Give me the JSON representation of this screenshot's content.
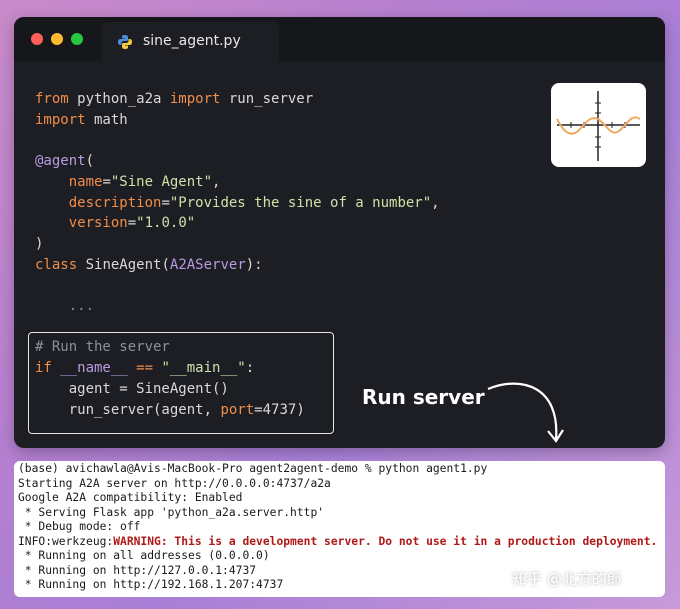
{
  "editor": {
    "tab_title": "sine_agent.py",
    "code": {
      "line1": {
        "kw_from": "from",
        "module": " python_a2a ",
        "kw_import": "import",
        "name": " run_server"
      },
      "line2": {
        "kw_import": "import",
        "name": " math"
      },
      "line4": {
        "decorator": "@agent",
        "paren": "("
      },
      "line5": {
        "indent": "    ",
        "param": "name",
        "eq": "=",
        "value": "\"Sine Agent\"",
        "comma": ","
      },
      "line6": {
        "indent": "    ",
        "param": "description",
        "eq": "=",
        "value": "\"Provides the sine of a number\"",
        "comma": ","
      },
      "line7": {
        "indent": "    ",
        "param": "version",
        "eq": "=",
        "value": "\"1.0.0\""
      },
      "line8": {
        "paren": ")"
      },
      "line9": {
        "kw_class": "class",
        "name": " SineAgent",
        "paren_open": "(",
        "base": "A2AServer",
        "paren_close": "):"
      },
      "line11": {
        "text": "    ..."
      },
      "line13": {
        "comment": "# Run the server"
      },
      "line14": {
        "kw_if": "if",
        "name": " __name__ ",
        "op": "==",
        "value": " \"__main__\"",
        "colon": ":"
      },
      "line15": {
        "text": "    agent = SineAgent()"
      },
      "line16": {
        "text_a": "    run_server(agent, ",
        "param": "port",
        "eq": "=",
        "num": "4737",
        "paren": ")"
      }
    }
  },
  "run_label": "Run server",
  "terminal": {
    "lines": [
      "(base) avichawla@Avis-MacBook-Pro agent2agent-demo % python agent1.py",
      "Starting A2A server on http://0.0.0.0:4737/a2a",
      "Google A2A compatibility: Enabled",
      " * Serving Flask app 'python_a2a.server.http'",
      " * Debug mode: off"
    ],
    "warning_prefix": "INFO:werkzeug:",
    "warning_text": "WARNING: This is a development server. Do not use it in a production deployment.",
    "after_lines": [
      " * Running on all addresses (0.0.0.0)",
      " * Running on http://127.0.0.1:4737",
      " * Running on http://192.168.1.207:4737"
    ]
  },
  "watermark": "知乎 @北方的郎",
  "colors": {
    "keyword": "#f08d49",
    "string": "#cfe0a8",
    "decorator": "#b89be0",
    "warning": "#b01818",
    "sine_curve": "#f0a860"
  },
  "icons": [
    "python-file-icon",
    "sine-graph-icon",
    "curved-arrow-icon"
  ]
}
